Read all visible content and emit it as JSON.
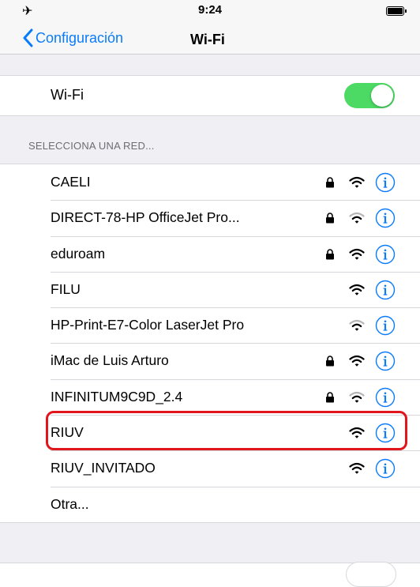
{
  "status_bar": {
    "time": "9:24",
    "airplane_icon": "airplane-icon",
    "battery_icon": "battery-icon"
  },
  "nav": {
    "back_label": "Configuración",
    "title": "Wi-Fi"
  },
  "wifi_toggle": {
    "label": "Wi-Fi",
    "on": true
  },
  "section_header": "SELECCIONA UNA RED...",
  "networks": [
    {
      "name": "CAELI",
      "locked": true,
      "signal": "full"
    },
    {
      "name": "DIRECT-78-HP OfficeJet Pro...",
      "locked": true,
      "signal": "weak"
    },
    {
      "name": "eduroam",
      "locked": true,
      "signal": "full"
    },
    {
      "name": "FILU",
      "locked": false,
      "signal": "full"
    },
    {
      "name": "HP-Print-E7-Color LaserJet Pro",
      "locked": false,
      "signal": "weak"
    },
    {
      "name": "iMac de Luis Arturo",
      "locked": true,
      "signal": "full"
    },
    {
      "name": "INFINITUM9C9D_2.4",
      "locked": true,
      "signal": "weak"
    },
    {
      "name": "RIUV",
      "locked": false,
      "signal": "full"
    },
    {
      "name": "RIUV_INVITADO",
      "locked": false,
      "signal": "full"
    },
    {
      "name": "Otra...",
      "other": true
    }
  ],
  "colors": {
    "accent": "#0a7cfa",
    "toggle_on": "#4cd964",
    "highlight": "#e0161c",
    "background": "#efeff4"
  }
}
